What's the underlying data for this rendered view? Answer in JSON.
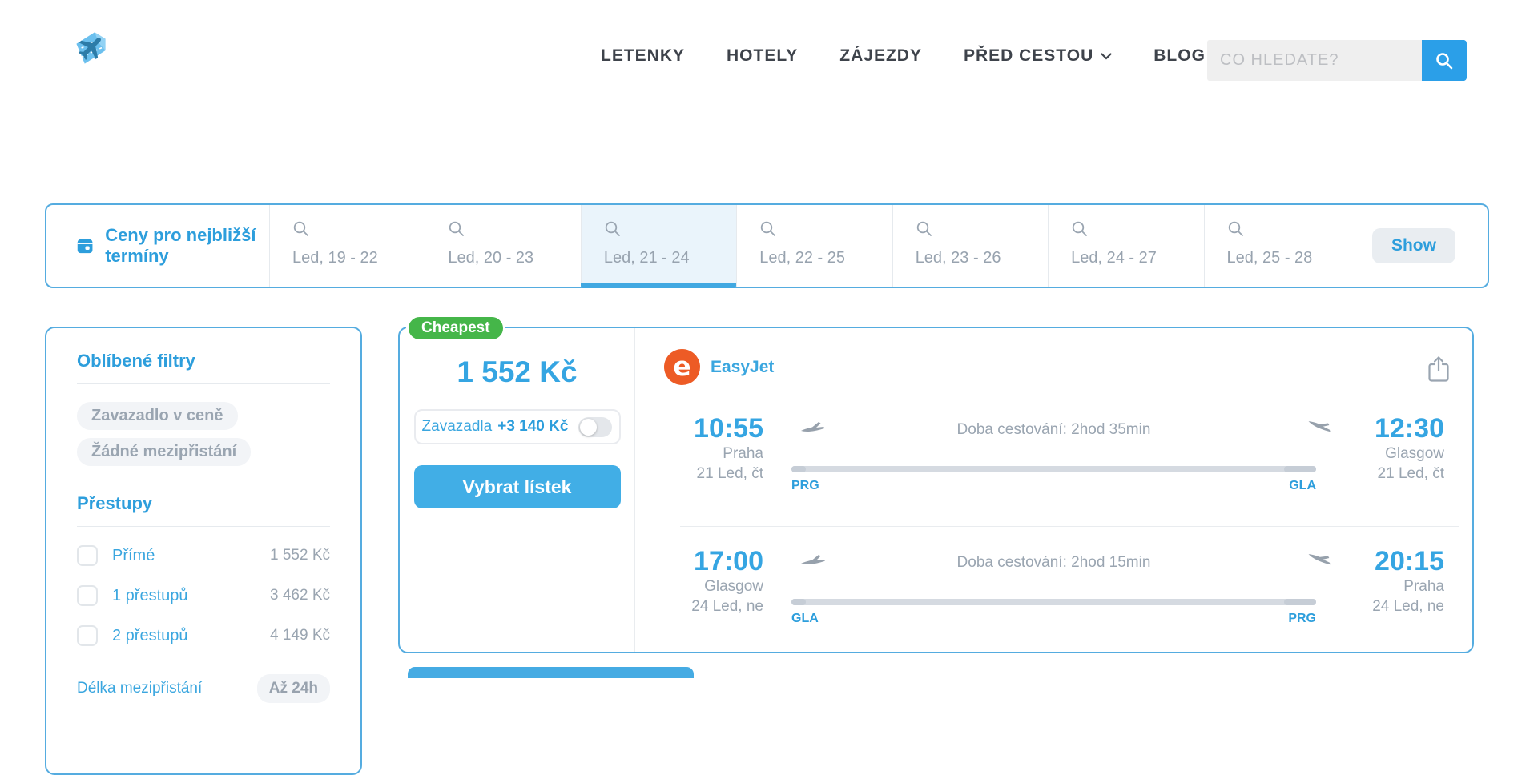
{
  "colors": {
    "accent_blue": "#2D9EDC",
    "button_blue": "#41AEE6",
    "border_blue": "#55ACE0",
    "badge_green": "#45B649",
    "easyjet_orange": "#ED5B25",
    "muted_gray": "#9AA5B1"
  },
  "header": {
    "nav": [
      {
        "label": "LETENKY"
      },
      {
        "label": "HOTELY"
      },
      {
        "label": "ZÁJEZDY"
      },
      {
        "label": "PŘED CESTOU",
        "has_dropdown": true
      },
      {
        "label": "BLOG"
      }
    ],
    "search": {
      "placeholder": "CO HLEDATE?",
      "value": ""
    }
  },
  "date_bar": {
    "title": "Ceny pro nejbližší termíny",
    "tabs": [
      {
        "label": "Led, 19 - 22",
        "selected": false
      },
      {
        "label": "Led, 20 - 23",
        "selected": false
      },
      {
        "label": "Led, 21 - 24",
        "selected": true
      },
      {
        "label": "Led, 22 - 25",
        "selected": false
      },
      {
        "label": "Led, 23 - 26",
        "selected": false
      },
      {
        "label": "Led, 24 - 27",
        "selected": false
      },
      {
        "label": "Led, 25 - 28",
        "selected": false
      }
    ],
    "show_button": "Show"
  },
  "filters": {
    "favorites_title": "Oblíbené filtry",
    "chips": [
      "Zavazadlo v ceně",
      "Žádné mezipřistání"
    ],
    "stops_title": "Přestupy",
    "stops": [
      {
        "label": "Přímé",
        "price": "1 552 Kč",
        "checked": false
      },
      {
        "label": "1 přestupů",
        "price": "3 462 Kč",
        "checked": false
      },
      {
        "label": "2 přestupů",
        "price": "4 149 Kč",
        "checked": false
      }
    ],
    "layover_label": "Délka mezipřistání",
    "layover_value": "Až 24h"
  },
  "result": {
    "badge": "Cheapest",
    "price": "1 552 Kč",
    "baggage_label": "Zavazadla",
    "baggage_price": "+3 140 Kč",
    "baggage_toggle_on": false,
    "select_button": "Vybrat lístek",
    "airline": "EasyJet",
    "airline_logo_letter": "e",
    "legs": [
      {
        "dep_time": "10:55",
        "dep_city": "Praha",
        "dep_date": "21 Led, čt",
        "dep_code": "PRG",
        "duration": "Doba cestování: 2hod 35min",
        "arr_time": "12:30",
        "arr_city": "Glasgow",
        "arr_date": "21 Led, čt",
        "arr_code": "GLA"
      },
      {
        "dep_time": "17:00",
        "dep_city": "Glasgow",
        "dep_date": "24 Led, ne",
        "dep_code": "GLA",
        "duration": "Doba cestování: 2hod 15min",
        "arr_time": "20:15",
        "arr_city": "Praha",
        "arr_date": "24 Led, ne",
        "arr_code": "PRG"
      }
    ]
  }
}
